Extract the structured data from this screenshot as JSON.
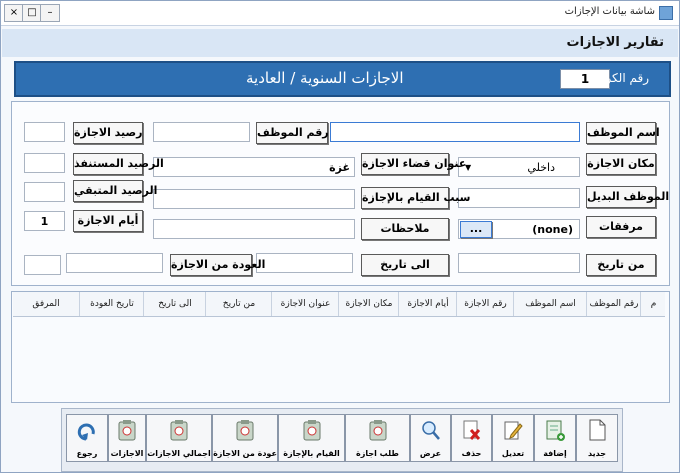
{
  "window": {
    "title": "شاشة بيانات الإجازات",
    "min": "–",
    "max": "□",
    "close": "×"
  },
  "header": {
    "title": "تقارير الاجازات"
  },
  "banner": {
    "title": "الاجازات السنوية / العادية",
    "card_label": "رقم الكرت",
    "card_value": "1"
  },
  "form": {
    "employee_name": "اسم الموظف",
    "employee_no": "رقم الموظف",
    "vacation_balance": "رصيد الاجازة",
    "vacation_place": "مكان الاجازة",
    "vacation_place_value": "داخلي",
    "vacation_address": "عنوان قضاء الاجازة",
    "vacation_address_value": "غزة",
    "used_balance": "الرصيد المستنفذ",
    "substitute": "الموظف البديل",
    "vacation_reason": "سبب القيام بالإجازة",
    "remaining_balance": "الرصيد المتبقي",
    "attachments": "مرفقات",
    "attachments_value": "(none)",
    "browse": "...",
    "notes": "ملاحظات",
    "vacation_days": "أيام الاجازة",
    "vacation_days_value": "1",
    "from_date": "من تاريخ",
    "to_date": "الى تاريخ",
    "return_label": "العودة من الاجازة"
  },
  "grid": {
    "columns": [
      "م",
      "رقم الموظف",
      "اسم الموظف",
      "رقم الاجازة",
      "أيام الاجازة",
      "مكان الاجازة",
      "عنوان الاجازة",
      "من تاريخ",
      "الى تاريخ",
      "تاريخ العودة",
      "المرفق"
    ]
  },
  "toolbar": {
    "new": "جديد",
    "add": "إضافة",
    "edit": "تعديل",
    "delete": "حذف",
    "view": "عرض",
    "request": "طلب اجازة",
    "start": "القيام بالإجازة",
    "return": "عودة من الاجازة",
    "total": "اجمالي الاجازات",
    "vacations": "الاجازات",
    "back": "رجوع"
  }
}
